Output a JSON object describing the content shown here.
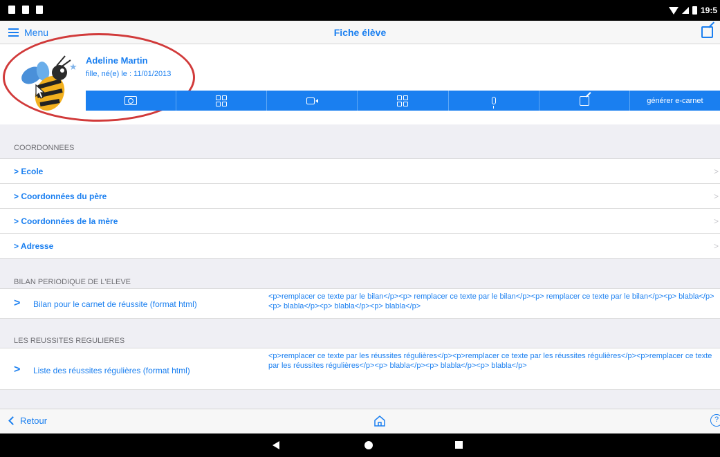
{
  "navbar": {
    "menu_label": "Menu",
    "title": "Fiche élève"
  },
  "status_bar": {
    "time": "19:5"
  },
  "student": {
    "name": "Adeline Martin",
    "subtitle": "fille, né(e) le : 11/01/2013"
  },
  "actions": {
    "generate_label": "générer e-carnet",
    "icons": [
      "camera-icon",
      "grid-icon",
      "video-icon",
      "grid-icon",
      "microphone-icon",
      "edit-icon"
    ]
  },
  "sections": {
    "coordonnees": {
      "header": "COORDONNEES",
      "items": [
        {
          "label": "> Ecole"
        },
        {
          "label": "> Coordonnées du père"
        },
        {
          "label": "> Coordonnées de la mère"
        },
        {
          "label": "> Adresse"
        }
      ],
      "arrow": ">"
    },
    "bilan": {
      "header": "BILAN PERIODIQUE DE L'ELEVE",
      "label": "Bilan pour le carnet de réussite (format html)",
      "value": "<p>remplacer ce texte par le bilan</p><p> remplacer ce texte par le bilan</p><p> remplacer ce texte par le bilan</p><p> blabla</p><p> blabla</p><p> blabla</p><p> blabla</p>"
    },
    "reussites": {
      "header": "LES REUSSITES REGULIERES",
      "label": "Liste des réussites régulières (format html)",
      "value": "<p>remplacer ce texte par les réussites régulières</p><p>remplacer ce texte par les réussites régulières</p><p>remplacer ce texte par les réussites régulières</p><p> blabla</p><p> blabla</p><p> blabla</p>"
    },
    "chevron": ">"
  },
  "footer": {
    "back_label": "Retour",
    "help_label": "?"
  },
  "colors": {
    "accent": "#1a7ff0",
    "annotation_ring": "#d13a3a",
    "section_bg": "#efeff4"
  }
}
